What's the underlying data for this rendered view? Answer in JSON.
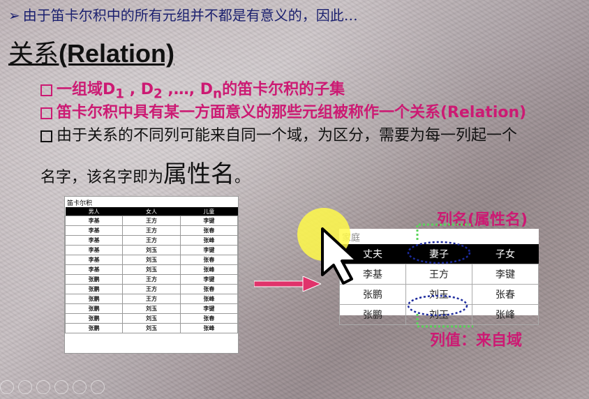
{
  "header": {
    "intro": "由于笛卡尔积中的所有元组并不都是有意义的，因此…",
    "title_zh": "关系",
    "title_en": "(Relation)"
  },
  "bullets": {
    "b1_prefix": "一组域D",
    "b1_sub1": "1",
    "b1_mid": " , D",
    "b1_sub2": "2",
    "b1_mid2": " ,…, D",
    "b1_subn": "n",
    "b1_suffix": "的笛卡尔积的子集",
    "b2": "笛卡尔积中具有某一方面意义的那些元组被称作一个关系(Relation)",
    "b3_line1": "由于关系的不同列可能来自同一个域，为区分，需要为每一列起一个",
    "b3_line2_a": "名字，该名字即为",
    "b3_line2_big": "属性名",
    "b3_line2_end": "。"
  },
  "cartesian": {
    "caption": "笛卡尔积",
    "headers": [
      "男人",
      "女人",
      "儿童"
    ],
    "rows": [
      [
        "李基",
        "王方",
        "李键"
      ],
      [
        "李基",
        "王方",
        "张春"
      ],
      [
        "李基",
        "王方",
        "张峰"
      ],
      [
        "李基",
        "刘玉",
        "李键"
      ],
      [
        "李基",
        "刘玉",
        "张春"
      ],
      [
        "李基",
        "刘玉",
        "张峰"
      ],
      [
        "张鹏",
        "王方",
        "李键"
      ],
      [
        "张鹏",
        "王方",
        "张春"
      ],
      [
        "张鹏",
        "王方",
        "张峰"
      ],
      [
        "张鹏",
        "刘玉",
        "李键"
      ],
      [
        "张鹏",
        "刘玉",
        "张春"
      ],
      [
        "张鹏",
        "刘玉",
        "张峰"
      ]
    ]
  },
  "relation": {
    "caption": "家庭",
    "headers": [
      "丈夫",
      "妻子",
      "子女"
    ],
    "rows": [
      [
        "李基",
        "王方",
        "李键"
      ],
      [
        "张鹏",
        "刘玉",
        "张春"
      ],
      [
        "张鹏",
        "刘玉",
        "张峰"
      ]
    ]
  },
  "labels": {
    "column_name": "列名(属性名)",
    "column_value": "列值：来自域"
  },
  "colors": {
    "accent": "#cc1a73",
    "intro": "#1a1f6e",
    "arrow": "#e0336b",
    "dotted_green": "#5bd35b",
    "dotted_blue": "#1c2a9c"
  }
}
